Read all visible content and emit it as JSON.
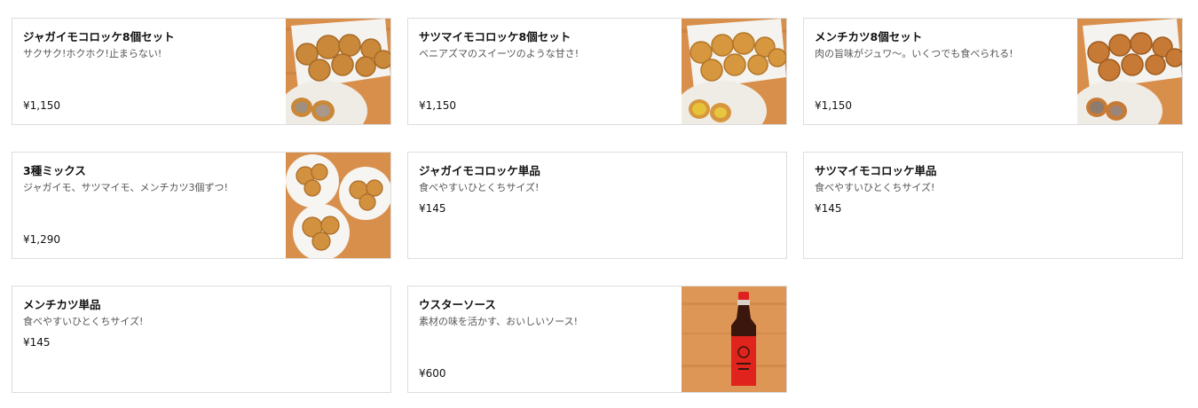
{
  "menu": {
    "items": [
      {
        "name": "ジャガイモコロッケ8個セット",
        "description": "サクサク!ホクホク!止まらない!",
        "price": "¥1,150",
        "image": "croquette-box-potato"
      },
      {
        "name": "サツマイモコロッケ8個セット",
        "description": "ベニアズマのスイーツのような甘さ!",
        "price": "¥1,150",
        "image": "croquette-box-sweet-potato"
      },
      {
        "name": "メンチカツ8個セット",
        "description": "肉の旨味がジュワ〜。いくつでも食べられる!",
        "price": "¥1,150",
        "image": "menchikatsu-box"
      },
      {
        "name": "3種ミックス",
        "description": "ジャガイモ、サツマイモ、メンチカツ3個ずつ!",
        "price": "¥1,290",
        "image": "mix-cups"
      },
      {
        "name": "ジャガイモコロッケ単品",
        "description": "食べやすいひとくちサイズ!",
        "price": "¥145",
        "image": ""
      },
      {
        "name": "サツマイモコロッケ単品",
        "description": "食べやすいひとくちサイズ!",
        "price": "¥145",
        "image": ""
      },
      {
        "name": "メンチカツ単品",
        "description": "食べやすいひとくちサイズ!",
        "price": "¥145",
        "image": ""
      },
      {
        "name": "ウスターソース",
        "description": "素材の味を活かす、おいしいソース!",
        "price": "¥600",
        "image": "sauce-bottle"
      }
    ]
  },
  "colors": {
    "border": "#dddddd",
    "wood": "#d9904a",
    "fried": "#c98a3c",
    "sauce_label": "#e0231c"
  }
}
